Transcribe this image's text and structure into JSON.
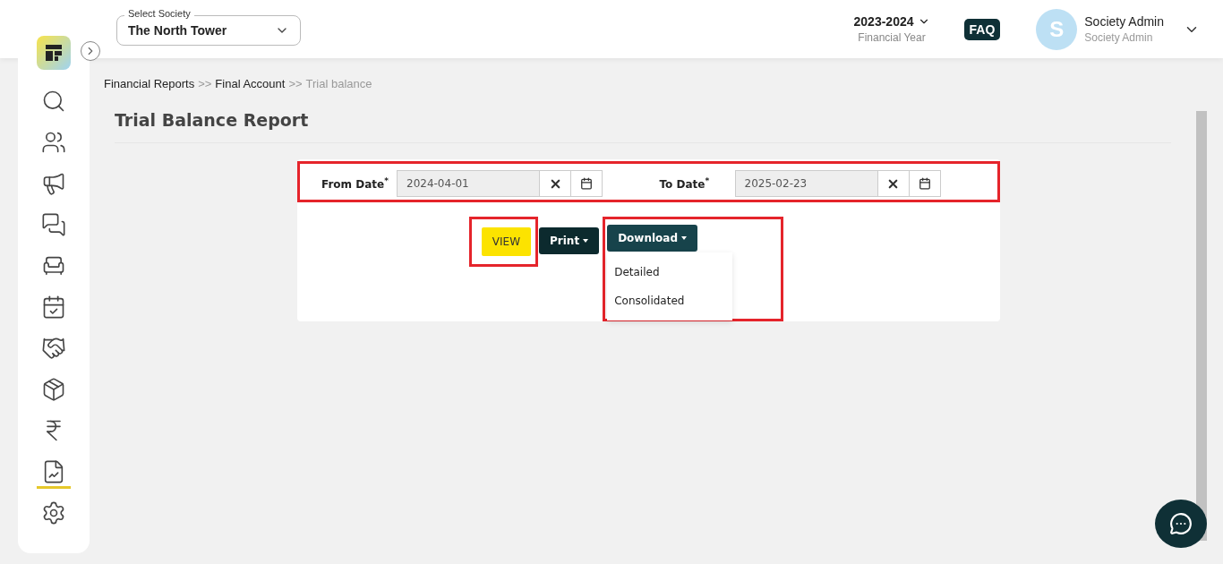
{
  "header": {
    "society_select": {
      "label": "Select Society",
      "value": "The North Tower"
    },
    "financial_year": {
      "value": "2023-2024",
      "caption": "Financial Year"
    },
    "faq": "FAQ",
    "user": {
      "initial": "S",
      "name": "Society Admin",
      "role": "Society Admin"
    }
  },
  "sidebar": {
    "items": [
      {
        "kind": "search",
        "selected": false
      },
      {
        "kind": "members",
        "selected": false
      },
      {
        "kind": "marketing",
        "selected": false
      },
      {
        "kind": "chat",
        "selected": false
      },
      {
        "kind": "desk",
        "selected": false
      },
      {
        "kind": "calendar",
        "selected": false
      },
      {
        "kind": "handshake",
        "selected": false
      },
      {
        "kind": "box",
        "selected": false
      },
      {
        "kind": "rupee",
        "selected": false
      },
      {
        "kind": "report",
        "selected": true
      },
      {
        "kind": "settings",
        "selected": false
      }
    ]
  },
  "breadcrumb": [
    {
      "label": "Financial Reports",
      "current": false
    },
    {
      "label": "Final Account",
      "current": false
    },
    {
      "label": "Trial balance",
      "current": true
    }
  ],
  "separator": ">>",
  "page_title": "Trial Balance Report",
  "dates": [
    {
      "label": "From Date",
      "required": "*",
      "value": "2024-04-01"
    },
    {
      "label": "To Date",
      "required": "*",
      "value": "2025-02-23"
    }
  ],
  "buttons": {
    "view": "VIEW",
    "print": "Print",
    "download": "Download"
  },
  "download_menu": [
    "Detailed",
    "Consolidated"
  ]
}
